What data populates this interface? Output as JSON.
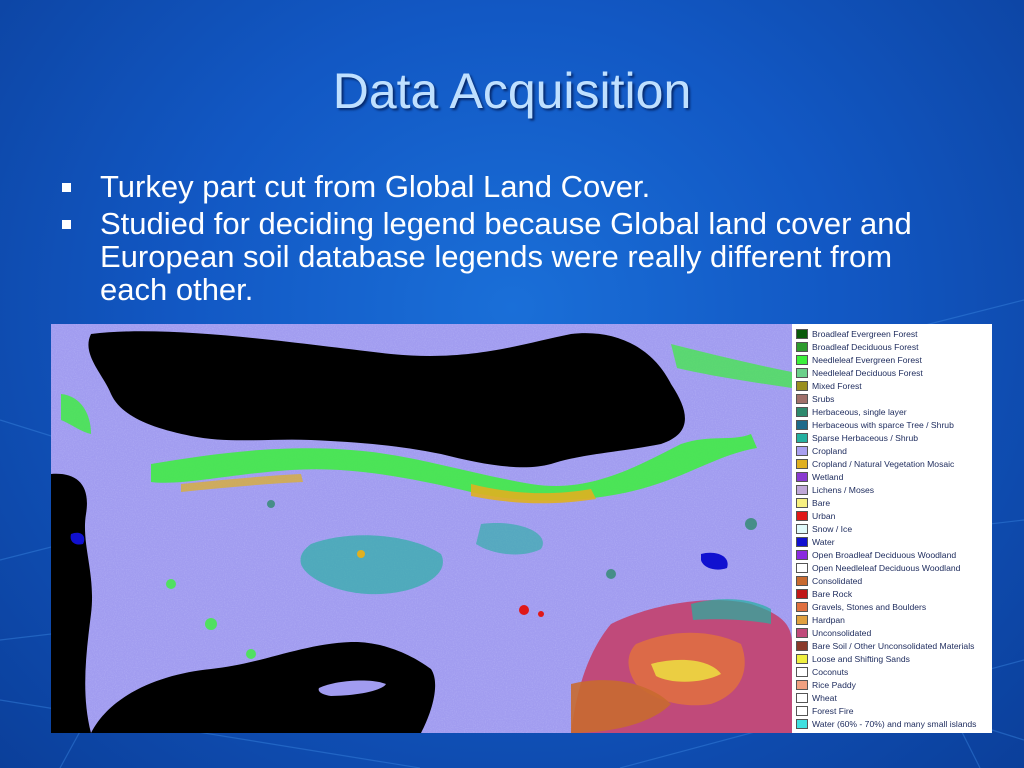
{
  "slide": {
    "title": "Data Acquisition",
    "bullets": [
      "Turkey part cut from Global Land Cover.",
      "Studied for deciding legend because Global land cover and European soil database legends were really different from each other."
    ]
  },
  "map": {
    "legend": [
      {
        "label": "Broadleaf Evergreen Forest",
        "color": "#0a5a0a"
      },
      {
        "label": "Broadleaf Deciduous Forest",
        "color": "#2d9b2d"
      },
      {
        "label": "Needleleaf Evergreen Forest",
        "color": "#3cf03c"
      },
      {
        "label": "Needleleaf Deciduous Forest",
        "color": "#6cd08a"
      },
      {
        "label": "Mixed Forest",
        "color": "#9a8f1e"
      },
      {
        "label": "Srubs",
        "color": "#a0706a"
      },
      {
        "label": "Herbaceous, single layer",
        "color": "#2e8a6e"
      },
      {
        "label": "Herbaceous with sparce Tree / Shrub",
        "color": "#1e6a8a"
      },
      {
        "label": "Sparse Herbaceous / Shrub",
        "color": "#24b0a0"
      },
      {
        "label": "Cropland",
        "color": "#a9a0f0"
      },
      {
        "label": "Cropland / Natural Vegetation Mosaic",
        "color": "#e0b020"
      },
      {
        "label": "Wetland",
        "color": "#8a3ad0"
      },
      {
        "label": "Lichens / Moses",
        "color": "#c0a8d8"
      },
      {
        "label": "Bare",
        "color": "#f8f080"
      },
      {
        "label": "Urban",
        "color": "#e01818"
      },
      {
        "label": "Snow / Ice",
        "color": "#e0fafa"
      },
      {
        "label": "Water",
        "color": "#1010d0"
      },
      {
        "label": "Open Broadleaf Deciduous Woodland",
        "color": "#8a2ae0"
      },
      {
        "label": "Open Needleleaf Deciduous Woodland",
        "color": "#ffffff"
      },
      {
        "label": "Consolidated",
        "color": "#c86a30"
      },
      {
        "label": "Bare Rock",
        "color": "#c01818"
      },
      {
        "label": "Gravels, Stones and Boulders",
        "color": "#e07040"
      },
      {
        "label": "Hardpan",
        "color": "#e0a040"
      },
      {
        "label": "Unconsolidated",
        "color": "#c04a7a"
      },
      {
        "label": "Bare Soil / Other Unconsolidated Materials",
        "color": "#8a3a2a"
      },
      {
        "label": "Loose and Shifting Sands",
        "color": "#f0f040"
      },
      {
        "label": "Coconuts",
        "color": "#ffffff"
      },
      {
        "label": "Rice Paddy",
        "color": "#f0a080"
      },
      {
        "label": "Wheat",
        "color": "#ffffff"
      },
      {
        "label": "Forest Fire",
        "color": "#ffffff"
      },
      {
        "label": "Water (60% - 70%) and many small islands",
        "color": "#40e0e0"
      }
    ]
  }
}
